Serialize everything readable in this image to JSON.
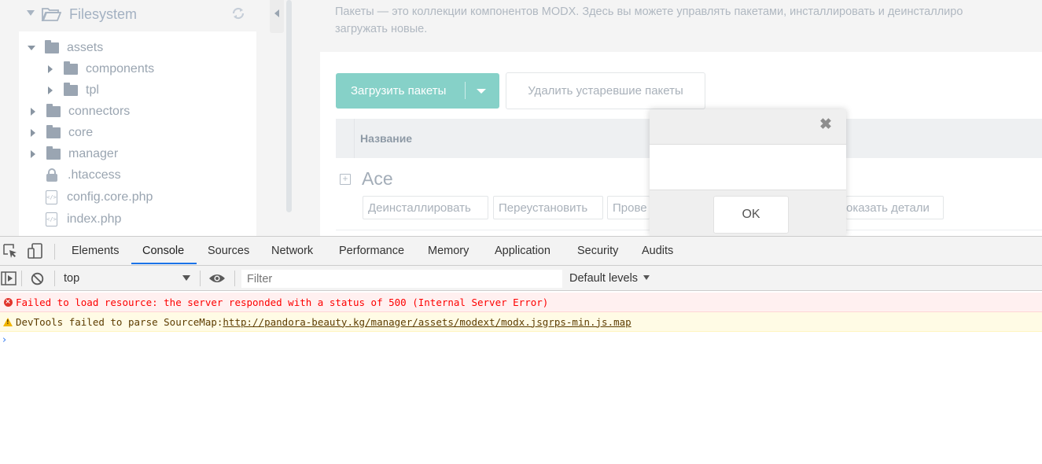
{
  "filesystem": {
    "title": "Filesystem",
    "items": [
      {
        "label": "assets",
        "kind": "folder",
        "state": "expanded"
      },
      {
        "label": "components",
        "kind": "folder",
        "state": "collapsed"
      },
      {
        "label": "tpl",
        "kind": "folder",
        "state": "collapsed"
      },
      {
        "label": "connectors",
        "kind": "folder",
        "state": "collapsed"
      },
      {
        "label": "core",
        "kind": "folder",
        "state": "collapsed"
      },
      {
        "label": "manager",
        "kind": "folder",
        "state": "collapsed"
      },
      {
        "label": ".htaccess",
        "kind": "locked-file"
      },
      {
        "label": "config.core.php",
        "kind": "file"
      },
      {
        "label": "index.php",
        "kind": "file"
      }
    ]
  },
  "packages": {
    "description_line1": "Пакеты — это коллекции компонентов MODX. Здесь вы можете управлять пакетами, инсталлировать и деинсталлиро",
    "description_line2": "загружать новые.",
    "upload_button": "Загрузить пакеты",
    "remove_outdated_button": "Удалить устаревшие пакеты",
    "column_name": "Название",
    "package_name": "Ace",
    "actions": {
      "uninstall": "Деинсталлировать",
      "reinstall": "Переустановить",
      "check": "Прове",
      "details": "оказать детали"
    },
    "accent_color": "#86d1c8"
  },
  "modal": {
    "close_symbol": "✖",
    "ok_button": "OK"
  },
  "devtools": {
    "tabs": [
      "Elements",
      "Console",
      "Sources",
      "Network",
      "Performance",
      "Memory",
      "Application",
      "Security",
      "Audits"
    ],
    "active_tab": "Console",
    "context": "top",
    "filter_placeholder": "Filter",
    "levels": "Default levels",
    "messages": [
      {
        "level": "error",
        "text": "Failed to load resource: the server responded with a status of 500 (Internal Server Error)"
      },
      {
        "level": "warning",
        "text": "DevTools failed to parse SourceMap: ",
        "link": "http://pandora-beauty.kg/manager/assets/modext/modx.jsgrps-min.js.map"
      }
    ],
    "prompt_symbol": "›",
    "error_color": "#fe0000",
    "link_color": "#1a73e8"
  }
}
